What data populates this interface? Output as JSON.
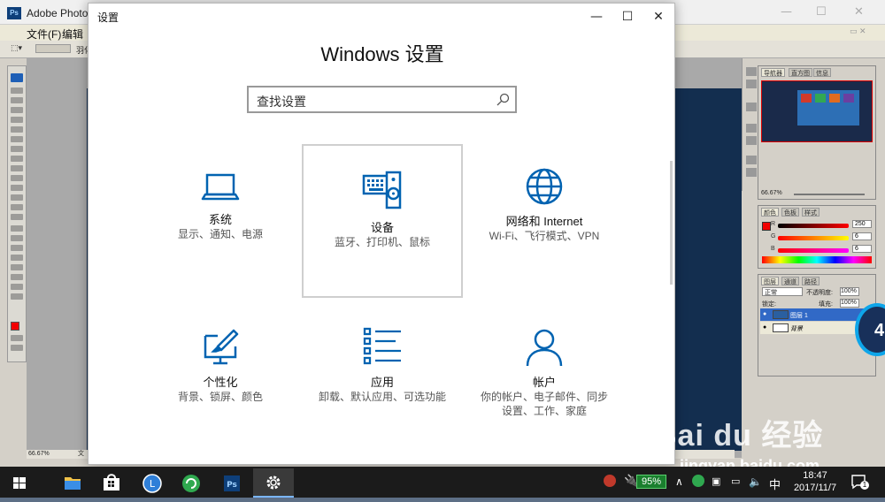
{
  "photoshop": {
    "title": "Adobe Photo",
    "menu": [
      "文件(F)",
      "编辑"
    ],
    "options_label": "羽化",
    "status_zoom": "66.67%",
    "status_doc": "文",
    "navigator": {
      "tabs": [
        "导航器",
        "直方图",
        "信息"
      ],
      "zoom": "66.67%"
    },
    "color_panel": {
      "tabs": [
        "颜色",
        "色板",
        "样式"
      ],
      "R": "250",
      "G": "6",
      "B": "6",
      "labels": [
        "R",
        "G",
        "B"
      ]
    },
    "layers_panel": {
      "tabs": [
        "图层",
        "通道",
        "路径"
      ],
      "blend_mode": "正常",
      "opacity_label": "不透明度:",
      "opacity": "100%",
      "lock_label": "锁定:",
      "fill_label": "填充:",
      "fill": "100%",
      "layers": [
        "图层 1",
        "背景"
      ]
    }
  },
  "settings": {
    "window_title": "设置",
    "heading": "Windows 设置",
    "search_placeholder": "查找设置",
    "tiles": [
      {
        "icon": "laptop-icon",
        "name": "系统",
        "desc": "显示、通知、电源"
      },
      {
        "icon": "keyboard-speaker-icon",
        "name": "设备",
        "desc": "蓝牙、打印机、鼠标"
      },
      {
        "icon": "globe-icon",
        "name": "网络和 Internet",
        "desc": "Wi-Fi、飞行模式、VPN"
      },
      {
        "icon": "paint-brush-icon",
        "name": "个性化",
        "desc": "背景、锁屏、颜色"
      },
      {
        "icon": "app-list-icon",
        "name": "应用",
        "desc": "卸载、默认应用、可选功能"
      },
      {
        "icon": "person-icon",
        "name": "帐户",
        "desc": "你的帐户、电子邮件、同步设置、工作、家庭"
      }
    ]
  },
  "float_badge": "4",
  "watermark": {
    "text": "Bai du 经验",
    "url": "jingyan.baidu.com"
  },
  "taskbar": {
    "battery": "95%",
    "ime": "中",
    "time": "18:47",
    "date": "2017/11/7",
    "notifications": "1"
  },
  "colors": {
    "accent": "#0063b1",
    "ps_fg": "#f20000",
    "taskbar": "#1b1b1b"
  }
}
